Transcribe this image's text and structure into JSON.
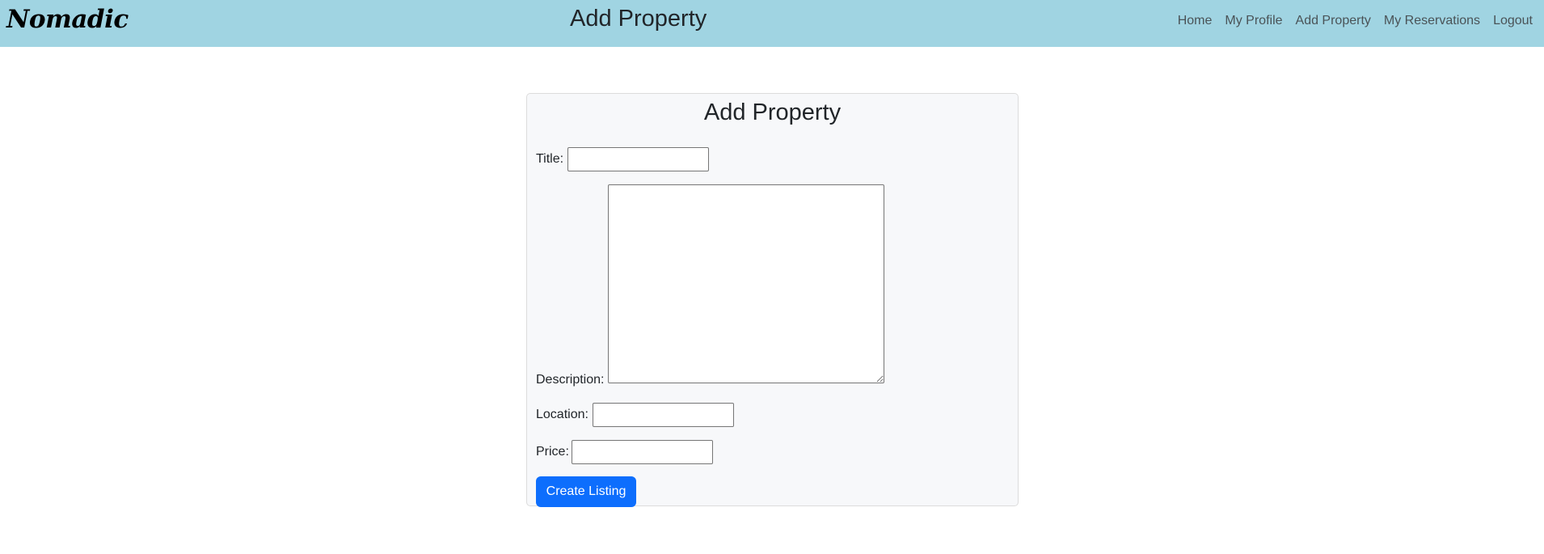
{
  "navbar": {
    "brand": "Nomadic",
    "title": "Add Property",
    "links": [
      "Home",
      "My Profile",
      "Add Property",
      "My Reservations",
      "Logout"
    ]
  },
  "form": {
    "heading": "Add Property",
    "fields": {
      "title": {
        "label": "Title:",
        "value": ""
      },
      "description": {
        "label": "Description:",
        "value": ""
      },
      "location": {
        "label": "Location:",
        "value": ""
      },
      "price": {
        "label": "Price:",
        "value": ""
      }
    },
    "submit_label": "Create Listing"
  },
  "colors": {
    "navbar_bg": "#a0d4e2",
    "card_bg": "#f7f8fa",
    "primary": "#0d6efd"
  }
}
